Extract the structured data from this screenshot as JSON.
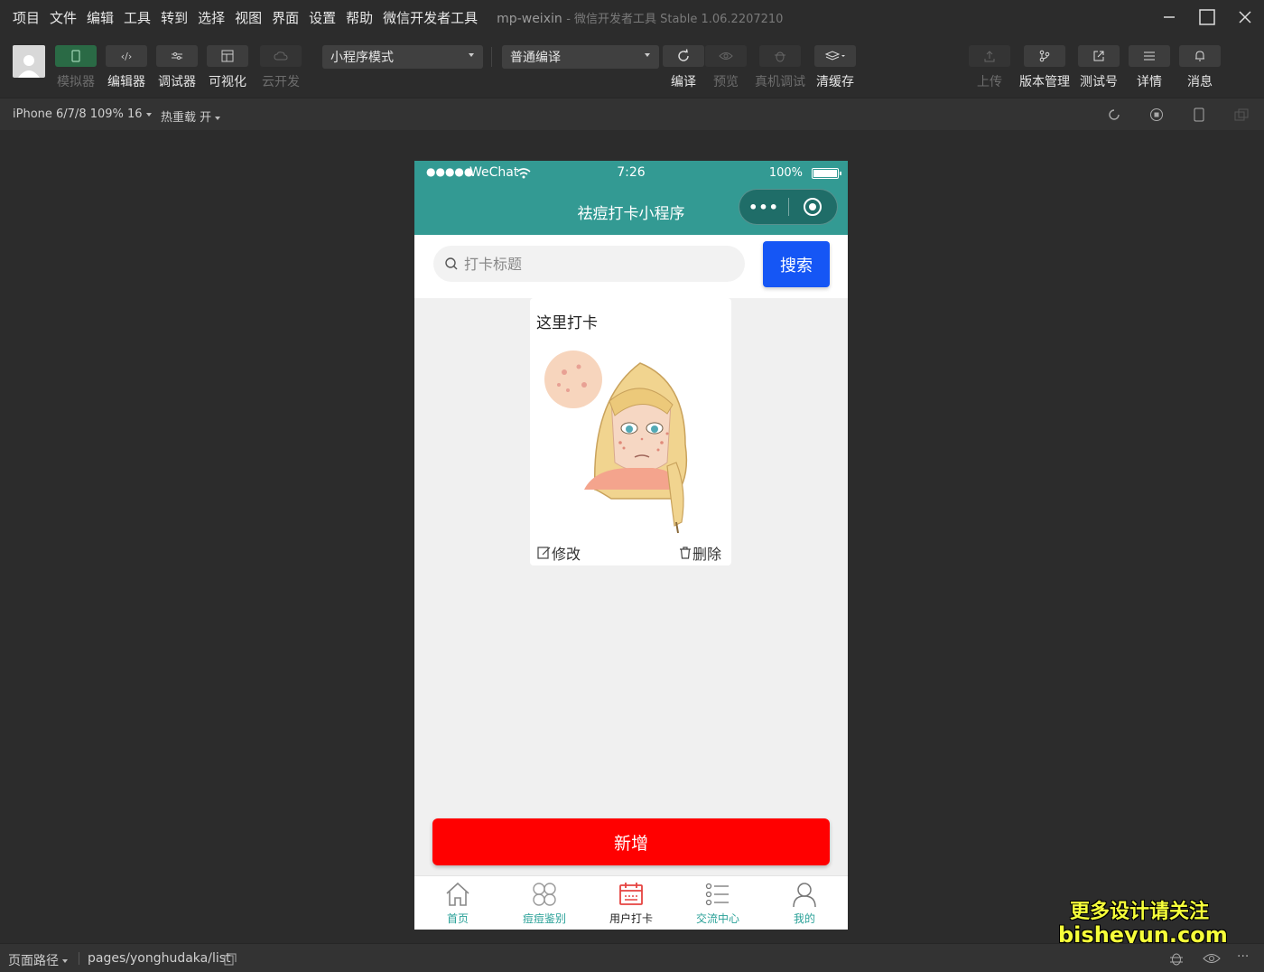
{
  "menu": [
    "项目",
    "文件",
    "编辑",
    "工具",
    "转到",
    "选择",
    "视图",
    "界面",
    "设置",
    "帮助",
    "微信开发者工具"
  ],
  "window": {
    "title": "mp-weixin",
    "subtitle": "- 微信开发者工具 Stable 1.06.2207210"
  },
  "toolbar": {
    "simulator": "模拟器",
    "editor": "编辑器",
    "debugger": "调试器",
    "visual": "可视化",
    "cloud": "云开发",
    "mode_select": "小程序模式",
    "compile_select": "普通编译",
    "compile": "编译",
    "preview": "预览",
    "remote_debug": "真机调试",
    "clear_cache": "清缓存",
    "upload": "上传",
    "version": "版本管理",
    "test_account": "测试号",
    "details": "详情",
    "messages": "消息"
  },
  "subbar": {
    "device": "iPhone 6/7/8 109% 16",
    "hot_reload": "热重载 开"
  },
  "phone": {
    "status": {
      "dots": "●●●●●",
      "carrier": "WeChat",
      "time": "7:26",
      "battery": "100%"
    },
    "nav_title": "祛痘打卡小程序",
    "capsule_more": "•••",
    "search": {
      "placeholder": "打卡标题",
      "button": "搜索"
    },
    "card": {
      "title": "这里打卡",
      "edit": "修改",
      "delete": "删除"
    },
    "add_button": "新增",
    "tabs": [
      {
        "label": "首页"
      },
      {
        "label": "痘痘鉴别"
      },
      {
        "label": "用户打卡"
      },
      {
        "label": "交流中心"
      },
      {
        "label": "我的"
      }
    ]
  },
  "bottombar": {
    "path_label": "页面路径",
    "path": "pages/yonghudaka/list"
  },
  "watermark": {
    "line1": "更多设计请关注",
    "line2": "bisheyun.com"
  },
  "colors": {
    "nav": "#339a93",
    "search_button": "#1556f5",
    "add_button": "#ff0000",
    "tab_active": "#2aa198"
  }
}
